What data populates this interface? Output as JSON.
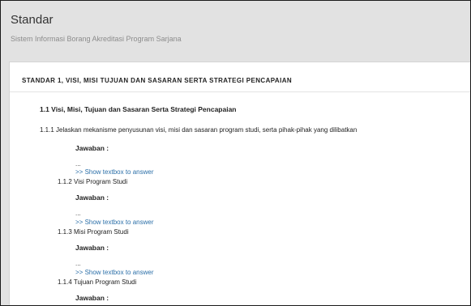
{
  "header": {
    "title": "Standar",
    "subtitle": "Sistem Informasi Borang Akreditasi Program Sarjana"
  },
  "standard": {
    "heading": "STANDAR 1, VISI, MISI TUJUAN DAN SASARAN SERTA STRATEGI PENCAPAIAN",
    "section_title": "1.1 Visi, Misi, Tujuan dan Sasaran Serta Strategi Pencapaian",
    "main_question": "1.1.1 Jelaskan mekanisme penyusunan visi, misi dan sasaran program studi, serta pihak-pihak yang dilibatkan",
    "answer_label": "Jawaban :",
    "answer_value": "...",
    "show_link": ">> Show textbox to answer",
    "sub_questions": [
      "1.1.2 Visi Program Studi",
      "1.1.3 Misi Program Studi",
      "1.1.4 Tujuan Program Studi"
    ]
  }
}
